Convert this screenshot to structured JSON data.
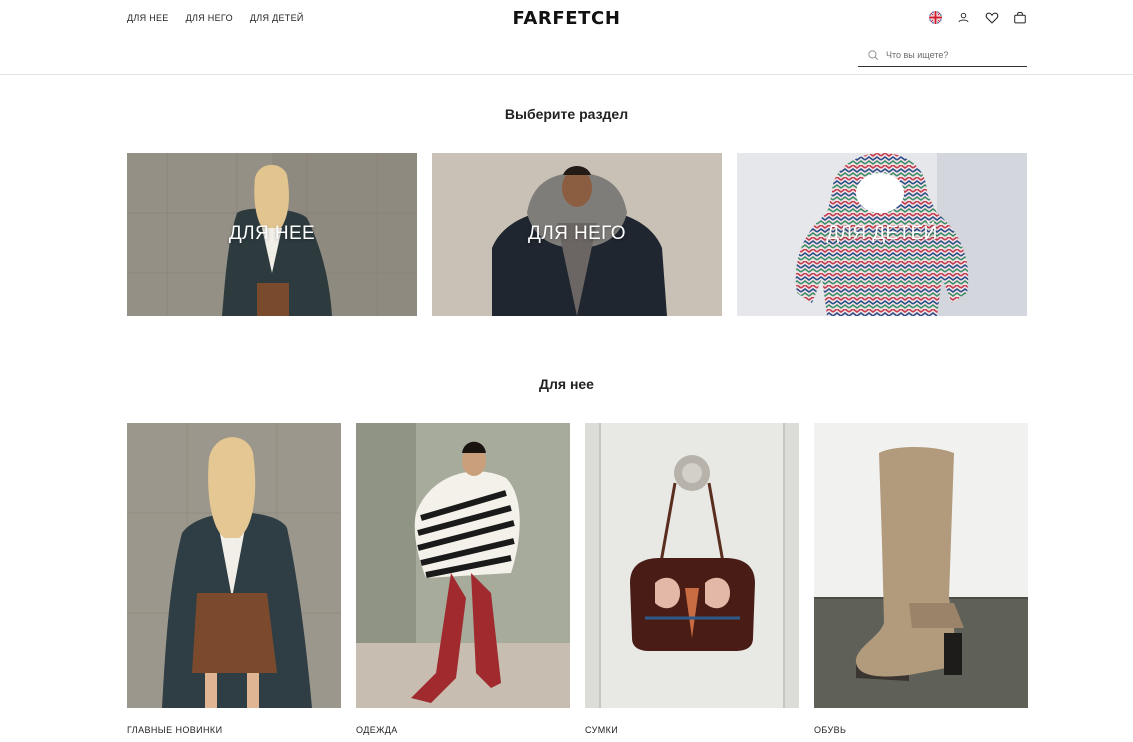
{
  "header": {
    "nav": [
      "ДЛЯ НЕЕ",
      "ДЛЯ НЕГО",
      "ДЛЯ ДЕТЕЙ"
    ],
    "logo": "FARFETCH",
    "icons": [
      "uk-flag-icon",
      "account-icon",
      "wishlist-heart-icon",
      "shopping-bag-icon"
    ],
    "search": {
      "placeholder": "Что вы ищете?",
      "value": ""
    }
  },
  "choose_section": {
    "title": "Выберите раздел",
    "tiles": [
      {
        "label": "ДЛЯ НЕЕ"
      },
      {
        "label": "ДЛЯ НЕГО"
      },
      {
        "label": "ДЛЯ ДЕТЕЙ"
      }
    ]
  },
  "women_section": {
    "title": "Для нее",
    "cards": [
      {
        "caption": "ГЛАВНЫЕ НОВИНКИ"
      },
      {
        "caption": "ОДЕЖДА"
      },
      {
        "caption": "СУМКИ"
      },
      {
        "caption": "ОБУВЬ"
      }
    ]
  },
  "colors": {
    "text": "#222222",
    "divider": "#e3e3e3",
    "background": "#ffffff"
  }
}
